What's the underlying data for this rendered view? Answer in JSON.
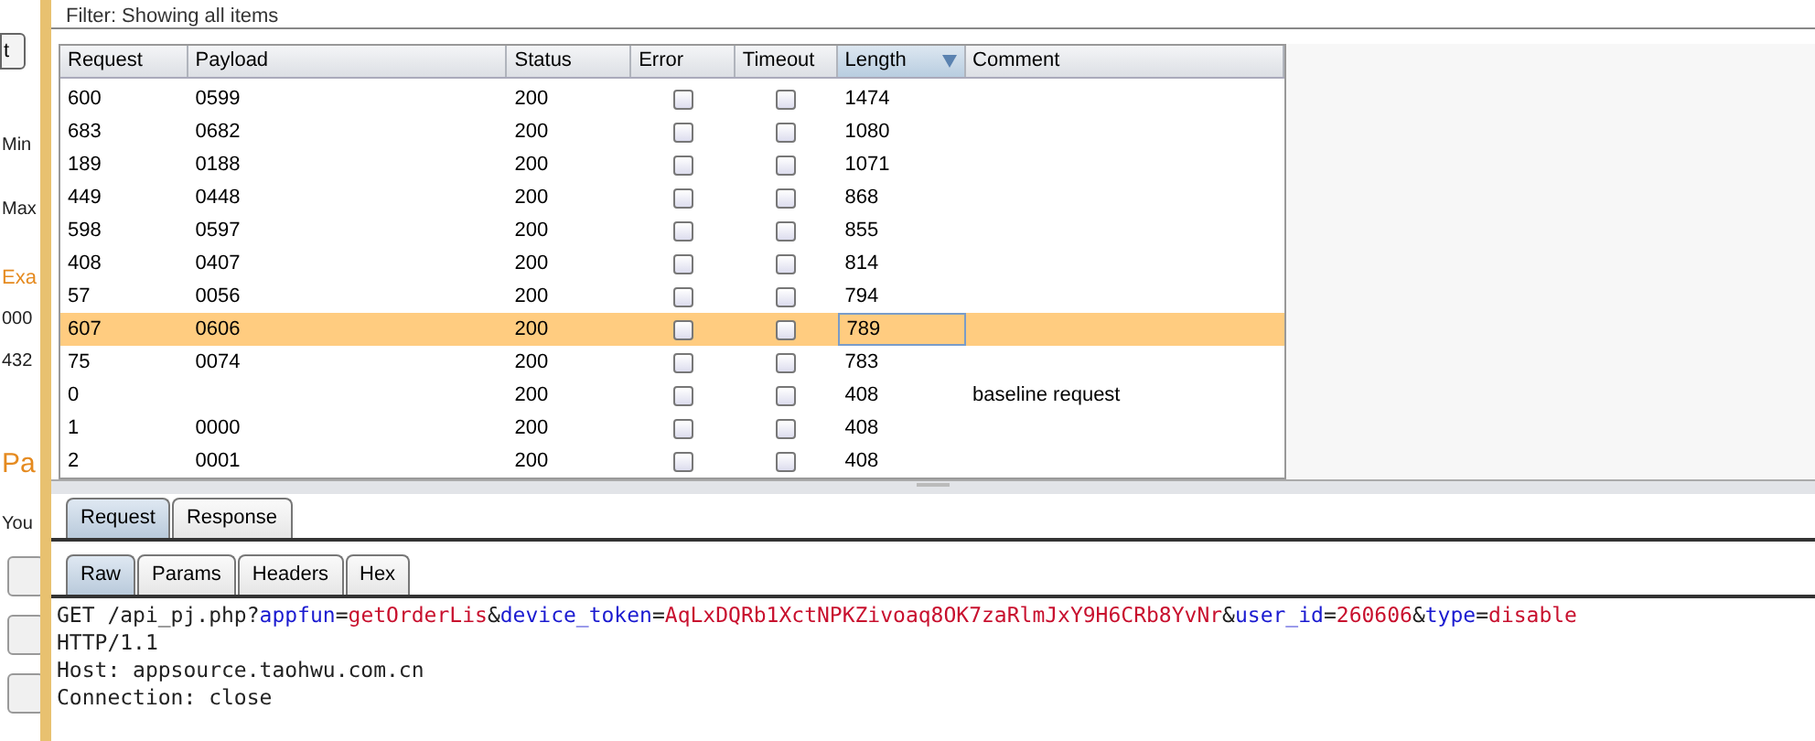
{
  "left_panel": {
    "tab": "t",
    "labels": [
      {
        "text": "Min",
        "kind": "plain"
      },
      {
        "text": "Max",
        "kind": "plain"
      },
      {
        "text": "Exa",
        "kind": "accent"
      },
      {
        "text": "000",
        "kind": "plain"
      },
      {
        "text": "432",
        "kind": "plain"
      },
      {
        "text": "Pa",
        "kind": "heading"
      },
      {
        "text": "You",
        "kind": "plain"
      }
    ]
  },
  "filter": "Filter: Showing all items",
  "table": {
    "columns": [
      {
        "label": "Request",
        "sorted": false
      },
      {
        "label": "Payload",
        "sorted": false
      },
      {
        "label": "Status",
        "sorted": false
      },
      {
        "label": "Error",
        "sorted": false
      },
      {
        "label": "Timeout",
        "sorted": false
      },
      {
        "label": "Length",
        "sorted": true
      },
      {
        "label": "Comment",
        "sorted": false
      }
    ],
    "rows": [
      {
        "request": "600",
        "payload": "0599",
        "status": "200",
        "error": false,
        "timeout": false,
        "length": "1474",
        "comment": "",
        "selected": false
      },
      {
        "request": "683",
        "payload": "0682",
        "status": "200",
        "error": false,
        "timeout": false,
        "length": "1080",
        "comment": "",
        "selected": false
      },
      {
        "request": "189",
        "payload": "0188",
        "status": "200",
        "error": false,
        "timeout": false,
        "length": "1071",
        "comment": "",
        "selected": false
      },
      {
        "request": "449",
        "payload": "0448",
        "status": "200",
        "error": false,
        "timeout": false,
        "length": "868",
        "comment": "",
        "selected": false
      },
      {
        "request": "598",
        "payload": "0597",
        "status": "200",
        "error": false,
        "timeout": false,
        "length": "855",
        "comment": "",
        "selected": false
      },
      {
        "request": "408",
        "payload": "0407",
        "status": "200",
        "error": false,
        "timeout": false,
        "length": "814",
        "comment": "",
        "selected": false
      },
      {
        "request": "57",
        "payload": "0056",
        "status": "200",
        "error": false,
        "timeout": false,
        "length": "794",
        "comment": "",
        "selected": false
      },
      {
        "request": "607",
        "payload": "0606",
        "status": "200",
        "error": false,
        "timeout": false,
        "length": "789",
        "comment": "",
        "selected": true
      },
      {
        "request": "75",
        "payload": "0074",
        "status": "200",
        "error": false,
        "timeout": false,
        "length": "783",
        "comment": "",
        "selected": false
      },
      {
        "request": "0",
        "payload": "",
        "status": "200",
        "error": false,
        "timeout": false,
        "length": "408",
        "comment": "baseline request",
        "selected": false
      },
      {
        "request": "1",
        "payload": "0000",
        "status": "200",
        "error": false,
        "timeout": false,
        "length": "408",
        "comment": "",
        "selected": false
      },
      {
        "request": "2",
        "payload": "0001",
        "status": "200",
        "error": false,
        "timeout": false,
        "length": "408",
        "comment": "",
        "selected": false
      }
    ]
  },
  "message_tabs": [
    {
      "label": "Request",
      "selected": true
    },
    {
      "label": "Response",
      "selected": false
    }
  ],
  "view_tabs": [
    {
      "label": "Raw",
      "selected": true
    },
    {
      "label": "Params",
      "selected": false
    },
    {
      "label": "Headers",
      "selected": false
    },
    {
      "label": "Hex",
      "selected": false
    }
  ],
  "request_lines": [
    [
      {
        "kind": "plain",
        "text": "GET /api_pj.php?"
      },
      {
        "kind": "name",
        "text": "appfun"
      },
      {
        "kind": "plain",
        "text": "="
      },
      {
        "kind": "value",
        "text": "getOrderLis"
      },
      {
        "kind": "plain",
        "text": "&"
      },
      {
        "kind": "name",
        "text": "device_token"
      },
      {
        "kind": "plain",
        "text": "="
      },
      {
        "kind": "value",
        "text": "AqLxDQRb1XctNPKZivoaq8OK7zaRlmJxY9H6CRb8YvNr"
      },
      {
        "kind": "plain",
        "text": "&"
      },
      {
        "kind": "name",
        "text": "user_id"
      },
      {
        "kind": "plain",
        "text": "="
      },
      {
        "kind": "value",
        "text": "260606"
      },
      {
        "kind": "plain",
        "text": "&"
      },
      {
        "kind": "name",
        "text": "type"
      },
      {
        "kind": "plain",
        "text": "="
      },
      {
        "kind": "value",
        "text": "disable"
      }
    ],
    [
      {
        "kind": "plain",
        "text": "HTTP/1.1"
      }
    ],
    [
      {
        "kind": "plain",
        "text": "Host: appsource.taohwu.com.cn"
      }
    ],
    [
      {
        "kind": "plain",
        "text": "Connection: close"
      }
    ]
  ]
}
